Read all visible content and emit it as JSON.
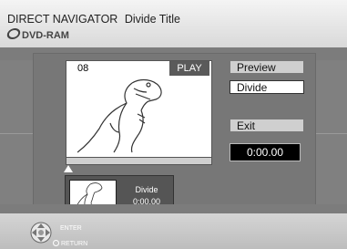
{
  "header": {
    "title": "DIRECT NAVIGATOR",
    "subtitle": "Divide Title",
    "media": "DVD-RAM"
  },
  "preview": {
    "title_number": "08",
    "status": "PLAY",
    "progress": 0.0
  },
  "split_thumb": {
    "label": "Divide",
    "time": "0:00.00"
  },
  "buttons": {
    "preview": "Preview",
    "divide": "Divide",
    "exit": "Exit"
  },
  "time_display": "0:00.00",
  "footer": {
    "enter": "ENTER",
    "return": "RETURN"
  },
  "icons": {
    "media": "dvd-disc-icon",
    "nav": "dpad-icon",
    "return": "return-circle-icon"
  }
}
